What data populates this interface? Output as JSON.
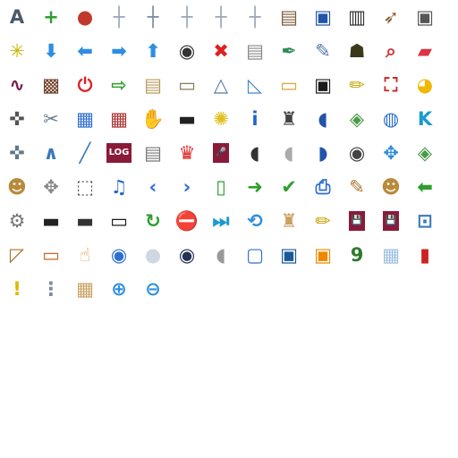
{
  "title": "",
  "icons": [
    {
      "name": "letter-a-circle-icon",
      "g": "A",
      "c": "#4a5a6a"
    },
    {
      "name": "add-green-icon",
      "g": "+",
      "c": "#2e9e2e"
    },
    {
      "name": "color-balls-icon",
      "g": "●",
      "c": "#c0392b"
    },
    {
      "name": "grid-dashed-icon",
      "g": "┼",
      "c": "#9aa6b8"
    },
    {
      "name": "grid-cross-icon",
      "g": "┼",
      "c": "#7a8aa0"
    },
    {
      "name": "grid-dashed-2-icon",
      "g": "┼",
      "c": "#9aa6b8"
    },
    {
      "name": "grid-dashed-3-icon",
      "g": "┼",
      "c": "#9aa6b8"
    },
    {
      "name": "grid-dashed-4-icon",
      "g": "┼",
      "c": "#9aa6b8"
    },
    {
      "name": "film-strip-icon",
      "g": "▤",
      "c": "#7a5a3a"
    },
    {
      "name": "arcade-machine-icon",
      "g": "▣",
      "c": "#2255aa"
    },
    {
      "name": "piano-keys-icon",
      "g": "▥",
      "c": "#333333"
    },
    {
      "name": "bow-arrow-icon",
      "g": "➶",
      "c": "#8b5a2b"
    },
    {
      "name": "mouse-keys-icon",
      "g": "▣",
      "c": "#555555"
    },
    {
      "name": "light-bulb-cfl-icon",
      "g": "✳",
      "c": "#c9b400"
    },
    {
      "name": "arrow-down-icon",
      "g": "⬇",
      "c": "#2f8ee0"
    },
    {
      "name": "arrow-left-icon",
      "g": "⬅",
      "c": "#2f8ee0"
    },
    {
      "name": "arrow-right-icon",
      "g": "➡",
      "c": "#2f8ee0"
    },
    {
      "name": "arrow-up-icon",
      "g": "⬆",
      "c": "#2f8ee0"
    },
    {
      "name": "camera-gear-icon",
      "g": "◉",
      "c": "#333333"
    },
    {
      "name": "red-x-icon",
      "g": "✖",
      "c": "#dd2222"
    },
    {
      "name": "document-delete-icon",
      "g": "▤",
      "c": "#888888"
    },
    {
      "name": "pen-nib-icon",
      "g": "✒",
      "c": "#2e8b57"
    },
    {
      "name": "selection-edit-icon",
      "g": "✎",
      "c": "#5577aa"
    },
    {
      "name": "bug-icon",
      "g": "☗",
      "c": "#3a3a1a"
    },
    {
      "name": "magnifier-bug-icon",
      "g": "⌕",
      "c": "#cc3333"
    },
    {
      "name": "eraser-icon",
      "g": "▰",
      "c": "#dd3344"
    },
    {
      "name": "squiggle-line-icon",
      "g": "∿",
      "c": "#7a1a4a"
    },
    {
      "name": "brown-texture-icon",
      "g": "▩",
      "c": "#6b3a22"
    },
    {
      "name": "power-red-icon",
      "g": "⏻",
      "c": "#dd2222"
    },
    {
      "name": "export-page-icon",
      "g": "⇨",
      "c": "#2e9e2e"
    },
    {
      "name": "document-scroll-icon",
      "g": "▤",
      "c": "#b89a5a"
    },
    {
      "name": "inbox-tray-icon",
      "g": "▭",
      "c": "#8a7a5a"
    },
    {
      "name": "geometry-triangle-icon",
      "g": "△",
      "c": "#5577aa"
    },
    {
      "name": "geometry-plane-icon",
      "g": "◺",
      "c": "#4488cc"
    },
    {
      "name": "folder-back-icon",
      "g": "▭",
      "c": "#d9a83a"
    },
    {
      "name": "monitor-score-icon",
      "g": "▣",
      "c": "#1a1a1a"
    },
    {
      "name": "pencil-icon",
      "g": "✏",
      "c": "#c9a200"
    },
    {
      "name": "fullscreen-window-icon",
      "g": "⛶",
      "c": "#cc2222"
    },
    {
      "name": "pacman-icon",
      "g": "◕",
      "c": "#f0b800"
    },
    {
      "name": "gamepad-icon",
      "g": "✜",
      "c": "#555555"
    },
    {
      "name": "tools-wrench-icon",
      "g": "✂",
      "c": "#6a7a8a"
    },
    {
      "name": "app-window-icon",
      "g": "▦",
      "c": "#2f6fd0"
    },
    {
      "name": "motherboard-icon",
      "g": "▦",
      "c": "#aa3333"
    },
    {
      "name": "hand-grab-icon",
      "g": "✋",
      "c": "#d9a060"
    },
    {
      "name": "handheld-console-icon",
      "g": "▬",
      "c": "#222222"
    },
    {
      "name": "light-bulb-icon",
      "g": "✺",
      "c": "#e0c020"
    },
    {
      "name": "info-icon",
      "g": "i",
      "c": "#2266cc"
    },
    {
      "name": "joystick-icon",
      "g": "♜",
      "c": "#444444"
    },
    {
      "name": "mouse-blue-icon",
      "g": "◖",
      "c": "#2255aa"
    },
    {
      "name": "map-layers-icon",
      "g": "◈",
      "c": "#4a9a4a"
    },
    {
      "name": "globe-grid-icon",
      "g": "◍",
      "c": "#2f6fd0"
    },
    {
      "name": "letter-k-icon",
      "g": "K",
      "c": "#1a9ad0"
    },
    {
      "name": "game-controller-icon",
      "g": "✜",
      "c": "#667788"
    },
    {
      "name": "polyline-icon",
      "g": "∧",
      "c": "#3a7ab8"
    },
    {
      "name": "line-diagonal-icon",
      "g": "╱",
      "c": "#3a7ab8"
    },
    {
      "name": "log-file-icon",
      "g": "LOG",
      "c": "#8a1a3a"
    },
    {
      "name": "text-document-icon",
      "g": "▤",
      "c": "#777777"
    },
    {
      "name": "mario-character-icon",
      "g": "♛",
      "c": "#dd2222"
    },
    {
      "name": "microphone-icon",
      "g": "🎤",
      "c": "#333333"
    },
    {
      "name": "mouse-dark-icon",
      "g": "◖",
      "c": "#333333"
    },
    {
      "name": "mouse-white-icon",
      "g": "◖",
      "c": "#aaaaaa"
    },
    {
      "name": "mouse-blue-2-icon",
      "g": "◗",
      "c": "#2255aa"
    },
    {
      "name": "camera-rig-icon",
      "g": "◉",
      "c": "#444444"
    },
    {
      "name": "move-arrows-icon",
      "g": "✥",
      "c": "#2f8ee0"
    },
    {
      "name": "map-terrain-icon",
      "g": "◈",
      "c": "#4a9a4a"
    },
    {
      "name": "viking-helmet-icon",
      "g": "☻",
      "c": "#b88a3a"
    },
    {
      "name": "move-points-icon",
      "g": "✥",
      "c": "#888888"
    },
    {
      "name": "select-pointer-icon",
      "g": "⬚",
      "c": "#555555"
    },
    {
      "name": "music-note-icon",
      "g": "♫",
      "c": "#2266cc"
    },
    {
      "name": "chevron-left-icon",
      "g": "‹",
      "c": "#2f6fd0"
    },
    {
      "name": "chevron-right-icon",
      "g": "›",
      "c": "#2f6fd0"
    },
    {
      "name": "new-document-icon",
      "g": "▯",
      "c": "#2e9e2e"
    },
    {
      "name": "go-forward-green-icon",
      "g": "➜",
      "c": "#2e9e2e"
    },
    {
      "name": "checkmark-icon",
      "g": "✔",
      "c": "#2e9e2e"
    },
    {
      "name": "printer-icon",
      "g": "⎙",
      "c": "#2f6fd0"
    },
    {
      "name": "art-brushes-icon",
      "g": "✎",
      "c": "#aa7733"
    },
    {
      "name": "viking-helmet-2-icon",
      "g": "☻",
      "c": "#b88a3a"
    },
    {
      "name": "go-back-green-icon",
      "g": "⬅",
      "c": "#2e9e2e"
    },
    {
      "name": "document-settings-icon",
      "g": "⚙",
      "c": "#777777"
    },
    {
      "name": "game-console-icon",
      "g": "▬",
      "c": "#222222"
    },
    {
      "name": "portable-player-icon",
      "g": "▬",
      "c": "#333333"
    },
    {
      "name": "psp-icon",
      "g": "▭",
      "c": "#1a1a1a"
    },
    {
      "name": "refresh-green-icon",
      "g": "↻",
      "c": "#2e9e2e"
    },
    {
      "name": "stop-red-icon",
      "g": "⛔",
      "c": "#dd2222"
    },
    {
      "name": "skip-end-icon",
      "g": "⏭",
      "c": "#1a9ad0"
    },
    {
      "name": "rotate-square-icon",
      "g": "⟲",
      "c": "#2f8ee0"
    },
    {
      "name": "sand-castle-icon",
      "g": "♜",
      "c": "#c9a060"
    },
    {
      "name": "pencil-edit-icon",
      "g": "✏",
      "c": "#c9a200"
    },
    {
      "name": "floppy-disk-icon",
      "g": "💾",
      "c": "#444444"
    },
    {
      "name": "floppy-disk-2-icon",
      "g": "💾",
      "c": "#444444"
    },
    {
      "name": "crop-icon",
      "g": "⊡",
      "c": "#3a7ab8"
    },
    {
      "name": "draw-diagonal-icon",
      "g": "◸",
      "c": "#aa7733"
    },
    {
      "name": "open-drawer-icon",
      "g": "▭",
      "c": "#cc6622"
    },
    {
      "name": "pointing-hand-icon",
      "g": "☝",
      "c": "#e0a050"
    },
    {
      "name": "screenshot-camera-icon",
      "g": "◉",
      "c": "#2f6fd0"
    },
    {
      "name": "pearl-ball-icon",
      "g": "●",
      "c": "#cfd8e0"
    },
    {
      "name": "speaker-icon",
      "g": "◉",
      "c": "#223355"
    },
    {
      "name": "mouse-outline-icon",
      "g": "◖",
      "c": "#999999"
    },
    {
      "name": "square-frame-icon",
      "g": "▢",
      "c": "#2f6fd0"
    },
    {
      "name": "tp-cube-icon",
      "g": "▣",
      "c": "#1a5a9a"
    },
    {
      "name": "crop-grid-icon",
      "g": "▣",
      "c": "#ee8800"
    },
    {
      "name": "sudoku-icon",
      "g": "9",
      "c": "#2e7a2e"
    },
    {
      "name": "checker-pattern-icon",
      "g": "▦",
      "c": "#9ac0e0"
    },
    {
      "name": "trash-bin-icon",
      "g": "▮",
      "c": "#cc2222"
    },
    {
      "name": "warning-icon",
      "g": "!",
      "c": "#e0b800"
    },
    {
      "name": "grid-dots-icon",
      "g": "⋮",
      "c": "#7a8aa0"
    },
    {
      "name": "cardboard-box-icon",
      "g": "▦",
      "c": "#c9a060"
    },
    {
      "name": "zoom-in-icon",
      "g": "⊕",
      "c": "#2f8ee0"
    },
    {
      "name": "zoom-out-icon",
      "g": "⊖",
      "c": "#2f8ee0"
    }
  ]
}
